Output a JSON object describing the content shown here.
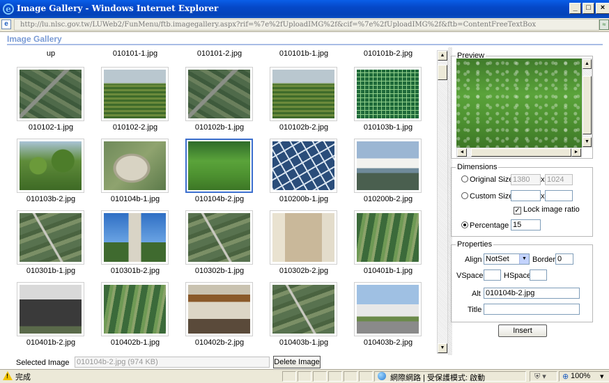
{
  "window": {
    "title": "Image Gallery - Windows Internet Explorer",
    "minimize": "_",
    "maximize": "□",
    "close": "×"
  },
  "address": {
    "url": "http://lu.nlsc.gov.tw/LUWeb2/FunMenu/ftb.imagegallery.aspx?rif=%7e%2fUploadIMG%2f&cif=%7e%2fUploadIMG%2f&ftb=ContentFreeTextBox"
  },
  "page": {
    "title": "Image Gallery"
  },
  "gallery": {
    "top_labels": [
      "up",
      "010101-1.jpg",
      "010101-2.jpg",
      "010101b-1.jpg",
      "010101b-2.jpg"
    ],
    "rows": [
      [
        {
          "label": "010102-1.jpg",
          "kind": "aerial"
        },
        {
          "label": "010102-2.jpg",
          "kind": "field"
        },
        {
          "label": "010102b-1.jpg",
          "kind": "aerial"
        },
        {
          "label": "010102b-2.jpg",
          "kind": "field"
        },
        {
          "label": "010103b-1.jpg",
          "kind": "grid"
        }
      ],
      [
        {
          "label": "010103b-2.jpg",
          "kind": "shrub"
        },
        {
          "label": "010104b-1.jpg",
          "kind": "quarry"
        },
        {
          "label": "010104b-2.jpg",
          "kind": "grass",
          "selected": true
        },
        {
          "label": "010200b-1.jpg",
          "kind": "ponds"
        },
        {
          "label": "010200b-2.jpg",
          "kind": "shore"
        }
      ],
      [
        {
          "label": "010301b-1.jpg",
          "kind": "aerial2"
        },
        {
          "label": "010301b-2.jpg",
          "kind": "tower"
        },
        {
          "label": "010302b-1.jpg",
          "kind": "aerial2"
        },
        {
          "label": "010302b-2.jpg",
          "kind": "building"
        },
        {
          "label": "010401b-1.jpg",
          "kind": "aerial3"
        }
      ],
      [
        {
          "label": "010401b-2.jpg",
          "kind": "greenhouse"
        },
        {
          "label": "010402b-1.jpg",
          "kind": "aerial3"
        },
        {
          "label": "010402b-2.jpg",
          "kind": "shed"
        },
        {
          "label": "010403b-1.jpg",
          "kind": "aerial2"
        },
        {
          "label": "010403b-2.jpg",
          "kind": "road"
        }
      ]
    ]
  },
  "preview": {
    "legend": "Preview"
  },
  "dimensions": {
    "legend": "Dimensions",
    "original_label": "Original Size",
    "original_width": "1380",
    "original_height": "1024",
    "x_sep": "x",
    "custom_label": "Custom Size",
    "custom_width": "",
    "custom_height": "",
    "lock_label": "Lock image ratio",
    "lock_check": "✓",
    "percentage_label": "Percentage",
    "percentage_value": "15"
  },
  "properties": {
    "legend": "Properties",
    "align_label": "Align",
    "align_value": "NotSet",
    "border_label": "Border",
    "border_value": "0",
    "vspace_label": "VSpace",
    "vspace_value": "",
    "hspace_label": "HSpace",
    "hspace_value": "",
    "alt_label": "Alt",
    "alt_value": "010104b-2.jpg",
    "title_label": "Title",
    "title_value": "",
    "insert_label": "Insert"
  },
  "selected": {
    "label": "Selected Image",
    "value": "010104b-2.jpg (974 KB)",
    "delete_label": "Delete Image"
  },
  "status": {
    "done": "完成",
    "zone": "網際網路 | 受保護模式: 啟動",
    "zoom": "100%"
  },
  "colors": {
    "titlebar": "#0548c8",
    "header_text": "#7b9cd6",
    "selected_border": "#3c6fce"
  }
}
